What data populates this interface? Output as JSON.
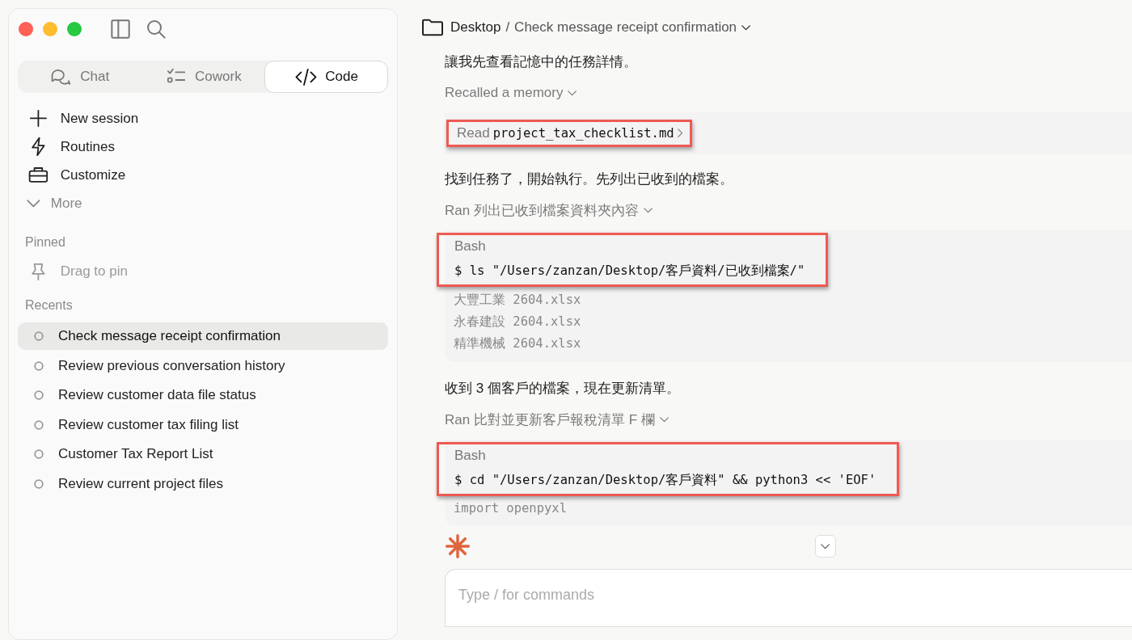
{
  "sidebar": {
    "tabs": [
      {
        "label": "Chat",
        "kind": "chat",
        "selected": false
      },
      {
        "label": "Cowork",
        "kind": "tasks",
        "selected": false
      },
      {
        "label": "Code",
        "kind": "code",
        "selected": true
      }
    ],
    "nav": [
      {
        "label": "New session",
        "kind": "plus",
        "muted": false
      },
      {
        "label": "Routines",
        "kind": "bolt",
        "muted": false
      },
      {
        "label": "Customize",
        "kind": "briefcase",
        "muted": false
      },
      {
        "label": "More",
        "kind": "chevron",
        "muted": true
      }
    ],
    "pinned": {
      "heading": "Pinned",
      "hint": "Drag to pin"
    },
    "recents": {
      "heading": "Recents",
      "items": [
        {
          "label": "Check message receipt confirmation",
          "selected": true
        },
        {
          "label": "Review previous conversation history",
          "selected": false
        },
        {
          "label": "Review customer data file status",
          "selected": false
        },
        {
          "label": "Review customer tax filing list",
          "selected": false
        },
        {
          "label": "Customer Tax Report List",
          "selected": false
        },
        {
          "label": "Review current project files",
          "selected": false
        }
      ]
    }
  },
  "main": {
    "breadcrumb": {
      "folder": "Desktop",
      "separator": "/",
      "title": "Check message receipt confirmation"
    },
    "messages": [
      {
        "kind": "text",
        "text": "讓我先查看記憶中的任務詳情。"
      },
      {
        "kind": "toggle",
        "text": "Recalled a memory"
      },
      {
        "kind": "read",
        "verb": "Read",
        "file": "project_tax_checklist.md",
        "highlighted": true
      },
      {
        "kind": "text",
        "text": "找到任務了，開始執行。先列出已收到的檔案。"
      },
      {
        "kind": "toggle",
        "text": "Ran 列出已收到檔案資料夾內容"
      },
      {
        "kind": "bash",
        "label": "Bash",
        "command": "$ ls \"/Users/zanzan/Desktop/客戶資料/已收到檔案/\"",
        "highlighted": true,
        "output": [
          "大豐工業 2604.xlsx",
          "永春建設 2604.xlsx",
          "精準機械 2604.xlsx"
        ]
      },
      {
        "kind": "text",
        "text": "收到 3 個客戶的檔案，現在更新清單。"
      },
      {
        "kind": "toggle",
        "text": "Ran 比對並更新客戶報稅清單 F 欄"
      },
      {
        "kind": "bash",
        "label": "Bash",
        "command": "$ cd \"/Users/zanzan/Desktop/客戶資料\" && python3 << 'EOF'",
        "highlighted": true,
        "output": [
          "import openpyxl"
        ]
      }
    ],
    "composer": {
      "placeholder": "Type / for commands"
    }
  }
}
